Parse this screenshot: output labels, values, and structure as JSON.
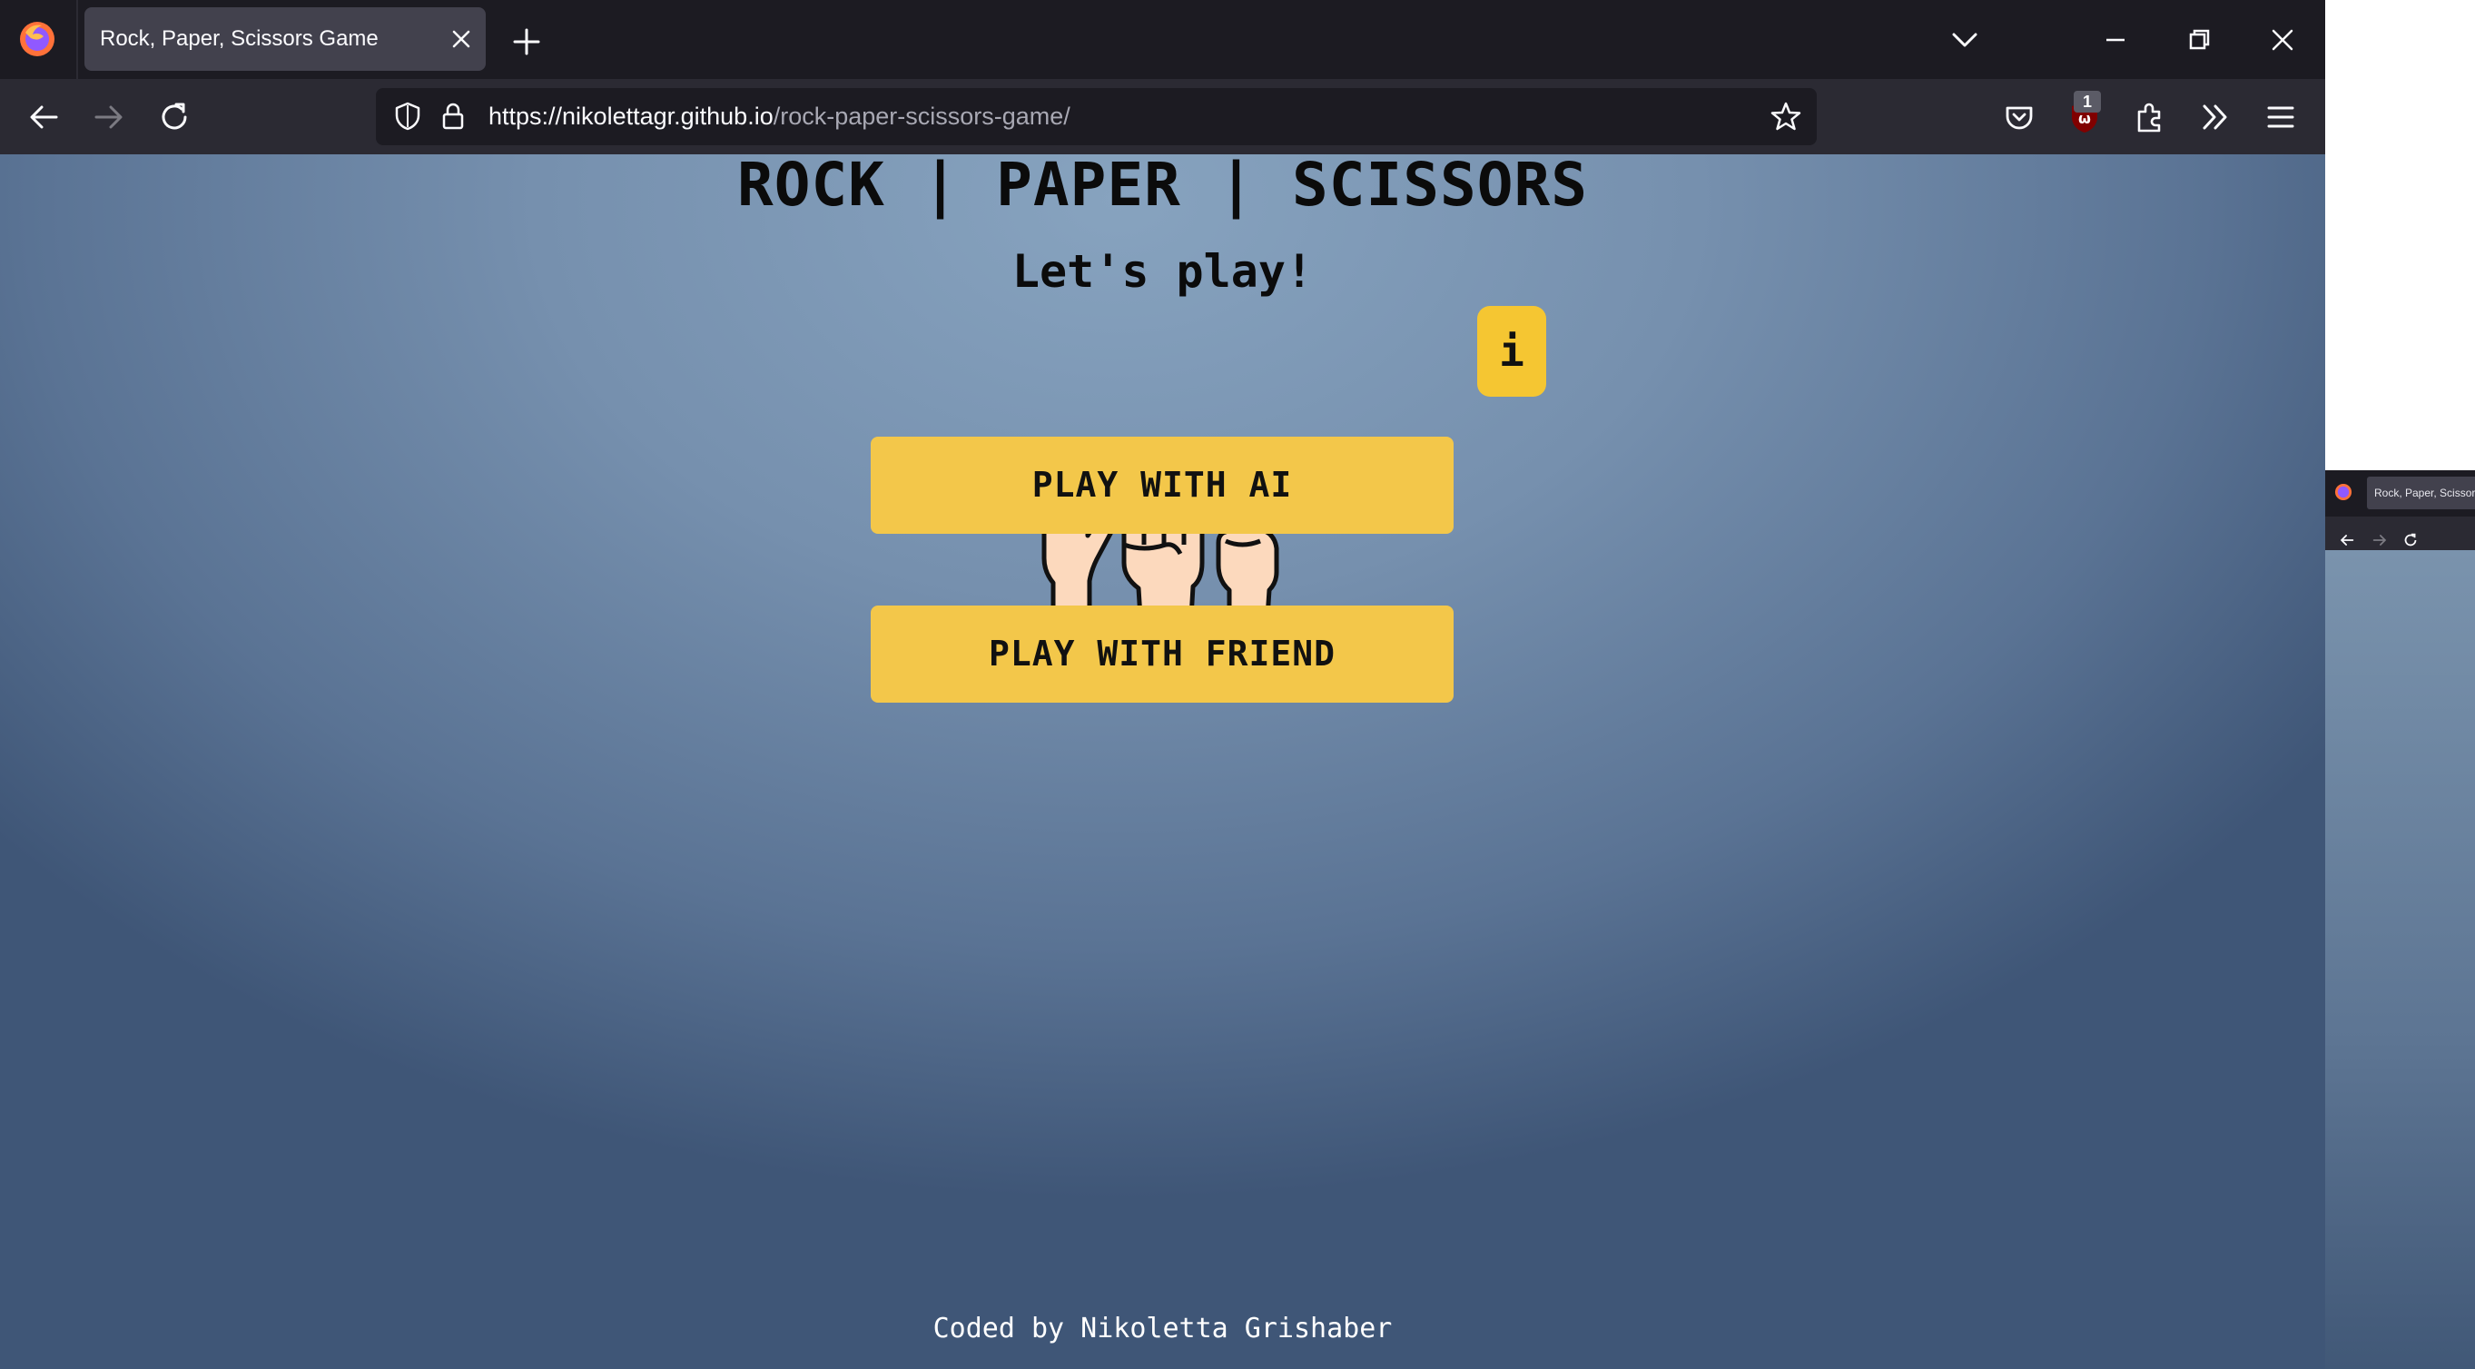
{
  "browser": {
    "tab_title": "Rock, Paper, Scissors Game",
    "url_host": "https://nikolettagr.github.io",
    "url_path": "/rock-paper-scissors-game/",
    "extension_badge": "1"
  },
  "page": {
    "title": "ROCK | PAPER | SCISSORS",
    "subtitle": "Let's play!",
    "info_label": "i",
    "buttons": {
      "play_ai": "PLAY WITH AI",
      "play_friend": "PLAY WITH FRIEND"
    },
    "footer": "Coded by Nikoletta Grishaber",
    "colors": {
      "button": "#f3c74a",
      "info_button": "#f5c632",
      "background_top": "#87a3bf",
      "background_bottom": "#3f5677"
    }
  },
  "second_window": {
    "tab_title": "Rock, Paper, Scissors"
  }
}
